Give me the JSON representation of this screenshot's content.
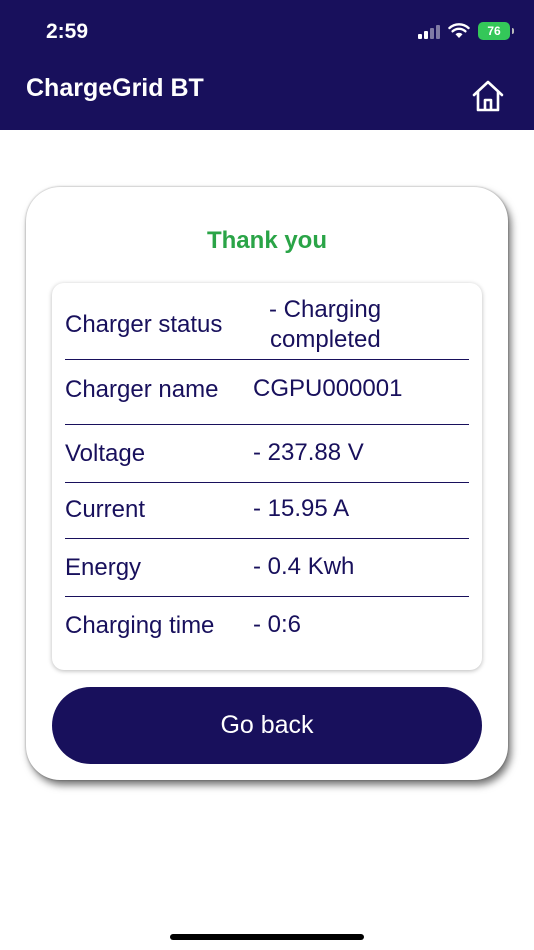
{
  "status_bar": {
    "time": "2:59",
    "battery": "76"
  },
  "header": {
    "title": "ChargeGrid BT",
    "home_icon": "home-icon"
  },
  "card": {
    "heading": "Thank you",
    "rows": [
      {
        "label": "Charger status",
        "value_line1": "- Charging",
        "value_line2": "completed"
      },
      {
        "label": "Charger name",
        "value": "CGPU000001"
      },
      {
        "label": "Voltage",
        "value": "- 237.88 V"
      },
      {
        "label": "Current",
        "value": "- 15.95 A"
      },
      {
        "label": "Energy",
        "value": "- 0.4 Kwh"
      },
      {
        "label": "Charging time",
        "value": "- 0:6"
      }
    ],
    "button": "Go back"
  },
  "colors": {
    "primary": "#18105c",
    "success": "#2aa447",
    "battery": "#34c759"
  }
}
